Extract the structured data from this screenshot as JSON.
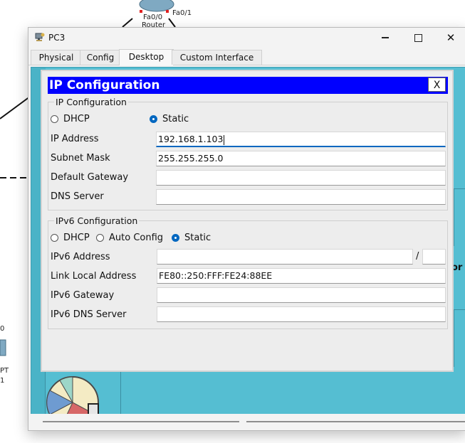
{
  "background": {
    "router_label": "Router",
    "iface_left": "Fa0/0",
    "iface_right": "Fa0/1",
    "pc_left_top": "0",
    "pc_left_mid": "PT",
    "pc_left_bot": "1"
  },
  "window": {
    "title": "PC3",
    "tabs": [
      "Physical",
      "Config",
      "Desktop",
      "Custom Interface"
    ],
    "active_tab": "Desktop",
    "edge_text": "or"
  },
  "dialog": {
    "title": "IP Configuration",
    "close_label": "X",
    "ipv4": {
      "legend": "IP Configuration",
      "dhcp_label": "DHCP",
      "static_label": "Static",
      "mode": "Static",
      "ip_address_label": "IP Address",
      "ip_address_value": "192.168.1.103",
      "subnet_mask_label": "Subnet Mask",
      "subnet_mask_value": "255.255.255.0",
      "default_gateway_label": "Default Gateway",
      "default_gateway_value": "",
      "dns_server_label": "DNS Server",
      "dns_server_value": ""
    },
    "ipv6": {
      "legend": "IPv6 Configuration",
      "dhcp_label": "DHCP",
      "auto_label": "Auto Config",
      "static_label": "Static",
      "mode": "Static",
      "address_label": "IPv6 Address",
      "address_value": "",
      "prefix_separator": "/",
      "prefix_value": "",
      "link_local_label": "Link Local Address",
      "link_local_value": "FE80::250:FFF:FE24:88EE",
      "gateway_label": "IPv6 Gateway",
      "gateway_value": "",
      "dns_label": "IPv6 DNS Server",
      "dns_value": ""
    }
  },
  "colors": {
    "dialog_header": "#0000ff",
    "desktop_bg": "#55bed2",
    "radio_selected": "#0067c0"
  }
}
